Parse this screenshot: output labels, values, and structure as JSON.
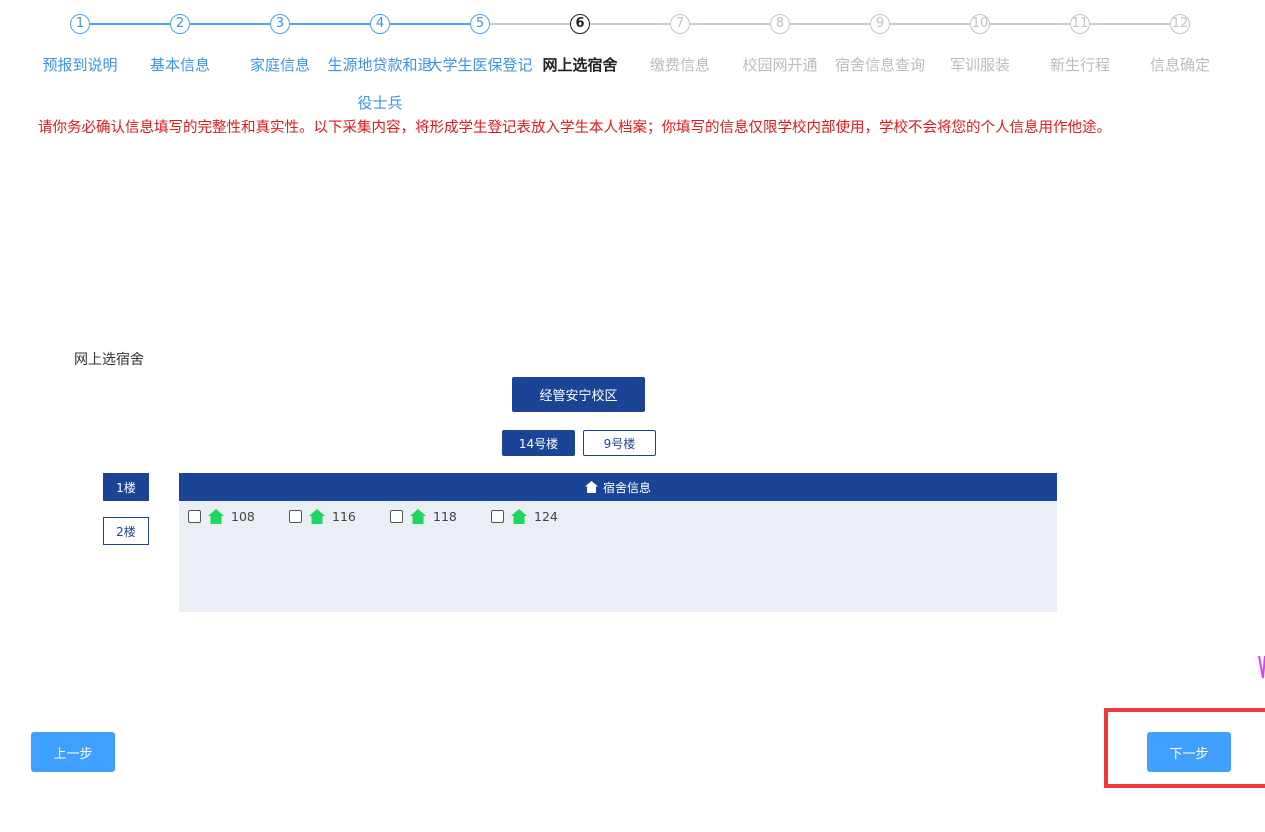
{
  "steps": [
    {
      "num": "1",
      "label": "预报到说明",
      "state": "done"
    },
    {
      "num": "2",
      "label": "基本信息",
      "state": "done"
    },
    {
      "num": "3",
      "label": "家庭信息",
      "state": "done"
    },
    {
      "num": "4",
      "label": "生源地贷款和退役士兵",
      "state": "done"
    },
    {
      "num": "5",
      "label": "大学生医保登记",
      "state": "done"
    },
    {
      "num": "6",
      "label": "网上选宿舍",
      "state": "current"
    },
    {
      "num": "7",
      "label": "缴费信息",
      "state": "todo"
    },
    {
      "num": "8",
      "label": "校园网开通",
      "state": "todo"
    },
    {
      "num": "9",
      "label": "宿舍信息查询",
      "state": "todo"
    },
    {
      "num": "10",
      "label": "军训服装",
      "state": "todo"
    },
    {
      "num": "11",
      "label": "新生行程",
      "state": "todo"
    },
    {
      "num": "12",
      "label": "信息确定",
      "state": "todo"
    }
  ],
  "notice": "请你务必确认信息填写的完整性和真实性。以下采集内容，将形成学生登记表放入学生本人档案；你填写的信息仅限学校内部使用，学校不会将您的个人信息用作他途。",
  "section": {
    "title": "网上选宿舍"
  },
  "campus": {
    "label": "经管安宁校区"
  },
  "buildings": [
    {
      "label": "14号楼",
      "active": true
    },
    {
      "label": "9号楼",
      "active": false
    }
  ],
  "floors": [
    {
      "label": "1楼",
      "active": true
    },
    {
      "label": "2楼",
      "active": false
    }
  ],
  "panel": {
    "title": "宿舍信息"
  },
  "rooms": [
    {
      "number": "108",
      "checked": false
    },
    {
      "number": "116",
      "checked": false
    },
    {
      "number": "118",
      "checked": false
    },
    {
      "number": "124",
      "checked": false
    }
  ],
  "nav": {
    "prev_label": "上一步",
    "next_label": "下一步"
  },
  "colors": {
    "primary": "#1c4496",
    "accent": "#40a0ff",
    "step_done": "#3a95e8",
    "step_todo": "#c0c4cc",
    "notice": "#e0191b",
    "room_icon": "#1ed760",
    "highlight": "#ee3a3a"
  }
}
